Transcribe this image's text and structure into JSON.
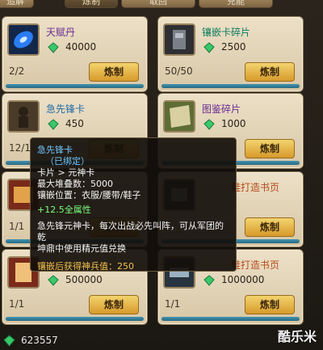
{
  "tabs": [
    "追解",
    "炼制",
    "取回",
    "充能"
  ],
  "cards": [
    {
      "name": "天赋丹",
      "price": "40000",
      "count": "2/2",
      "button": "炼制",
      "name_color": "#6a2b91"
    },
    {
      "name": "镶嵌卡碎片",
      "price": "2500",
      "count": "50/50",
      "button": "炼制",
      "name_color": "#0b7a5d"
    },
    {
      "name": "急先锋卡",
      "price": "450",
      "count": "12/1",
      "button": "炼制",
      "name_color": "#1f6aa6"
    },
    {
      "name": "图鉴碎片",
      "price": "1000",
      "count": "",
      "button": "炼制",
      "name_color": "#6a2b91"
    },
    {
      "name": "",
      "price": "",
      "count": "1/1",
      "button": "炼制",
      "name_color": "#333"
    },
    {
      "name": "鞋打造书页",
      "price": "",
      "count": "",
      "button": "炼制",
      "name_color": "#b44a1a"
    },
    {
      "name": "",
      "price": "500000",
      "count": "1/1",
      "button": "炼制",
      "name_color": "#333"
    },
    {
      "name": "鞋打造书页",
      "price": "1000000",
      "count": "1/1",
      "button": "炼制",
      "name_color": "#b44a1a"
    }
  ],
  "tooltip": {
    "name": "急先锋卡",
    "bound": "（已绑定）",
    "category": "卡片 > 元神卡",
    "stack": "最大堆叠数：5000",
    "slots": "镶嵌位置：衣服/腰带/鞋子",
    "bonus": "+12.5全属性",
    "desc1": "急先锋元神卡，每次出战必先叫阵，可从军团的乾",
    "desc2": "坤鼎中使用精元值兑换",
    "reward": "镶嵌后获得神兵值：250"
  },
  "currency": {
    "value": "623557"
  },
  "watermark": "酷乐米",
  "colors": {
    "gem": "#38c86a",
    "button": "#e0ad3c",
    "bar": "#3a8aa8"
  }
}
